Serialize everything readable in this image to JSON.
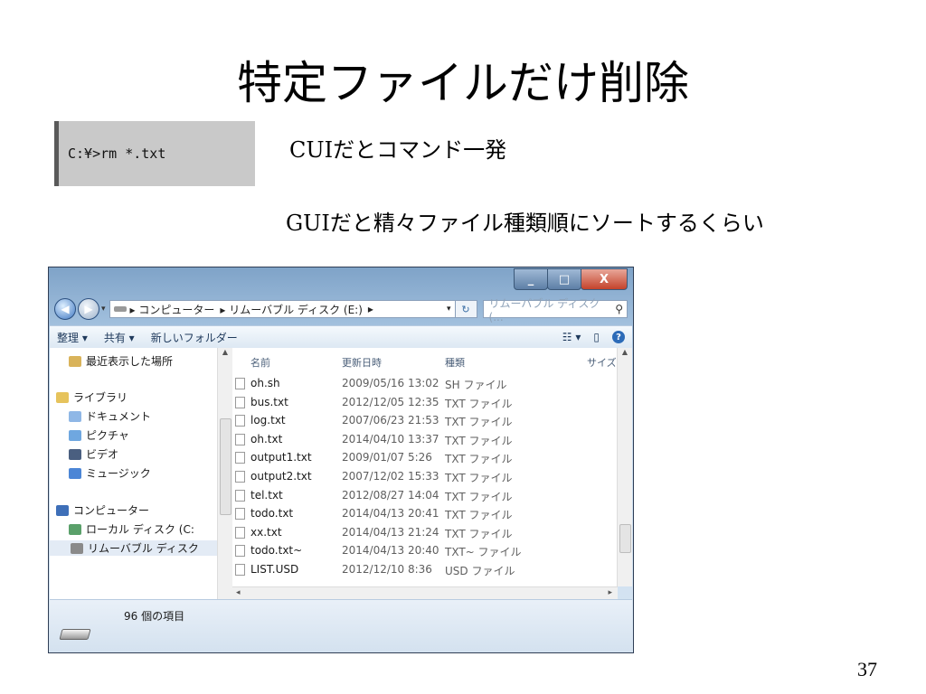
{
  "slide": {
    "title": "特定ファイルだけ削除",
    "command": "C:¥>rm *.txt",
    "cui_text": "CUIだとコマンド一発",
    "gui_text": "GUIだと精々ファイル種類順にソートするくらい",
    "page_number": "37"
  },
  "window": {
    "controls": {
      "minimize": "_",
      "maximize": "□",
      "close": "X"
    },
    "address": {
      "crumbs": [
        "▸ コンピューター",
        "▸ リムーバブル ディスク (E:)",
        "▸"
      ],
      "search_placeholder": "リムーバブル ディスク (..."
    },
    "toolbar": {
      "organize": "整理 ▾",
      "share": "共有 ▾",
      "new_folder": "新しいフォルダー"
    },
    "nav": [
      {
        "label": "最近表示した場所",
        "icon": "recent-places-icon",
        "color": "#d9b35a"
      },
      {
        "label": "ライブラリ",
        "icon": "library-icon",
        "color": "#e6c35c"
      },
      {
        "label": "ドキュメント",
        "icon": "documents-icon",
        "color": "#8fb7e6"
      },
      {
        "label": "ピクチャ",
        "icon": "pictures-icon",
        "color": "#6fa7e0"
      },
      {
        "label": "ビデオ",
        "icon": "videos-icon",
        "color": "#4a5f80"
      },
      {
        "label": "ミュージック",
        "icon": "music-icon",
        "color": "#4c86d6"
      },
      {
        "label": "コンピューター",
        "icon": "computer-icon",
        "color": "#3e6fb8"
      },
      {
        "label": "ローカル ディスク (C:",
        "icon": "local-disk-icon",
        "color": "#5aa06a"
      },
      {
        "label": "リムーバブル ディスク",
        "icon": "removable-disk-icon",
        "color": "#8a8a8a"
      }
    ],
    "columns": {
      "name": "名前",
      "date": "更新日時",
      "type": "種類",
      "size": "サイズ"
    },
    "files": [
      {
        "name": "oh.sh",
        "date": "2009/05/16 13:02",
        "type": "SH ファイル"
      },
      {
        "name": "bus.txt",
        "date": "2012/12/05 12:35",
        "type": "TXT ファイル"
      },
      {
        "name": "log.txt",
        "date": "2007/06/23 21:53",
        "type": "TXT ファイル"
      },
      {
        "name": "oh.txt",
        "date": "2014/04/10 13:37",
        "type": "TXT ファイル"
      },
      {
        "name": "output1.txt",
        "date": "2009/01/07 5:26",
        "type": "TXT ファイル"
      },
      {
        "name": "output2.txt",
        "date": "2007/12/02 15:33",
        "type": "TXT ファイル"
      },
      {
        "name": "tel.txt",
        "date": "2012/08/27 14:04",
        "type": "TXT ファイル"
      },
      {
        "name": "todo.txt",
        "date": "2014/04/13 20:41",
        "type": "TXT ファイル"
      },
      {
        "name": "xx.txt",
        "date": "2014/04/13 21:24",
        "type": "TXT ファイル"
      },
      {
        "name": "todo.txt~",
        "date": "2014/04/13 20:40",
        "type": "TXT~ ファイル"
      },
      {
        "name": "LIST.USD",
        "date": "2012/12/10 8:36",
        "type": "USD ファイル"
      }
    ],
    "status": {
      "item_count": "96 個の項目"
    }
  }
}
